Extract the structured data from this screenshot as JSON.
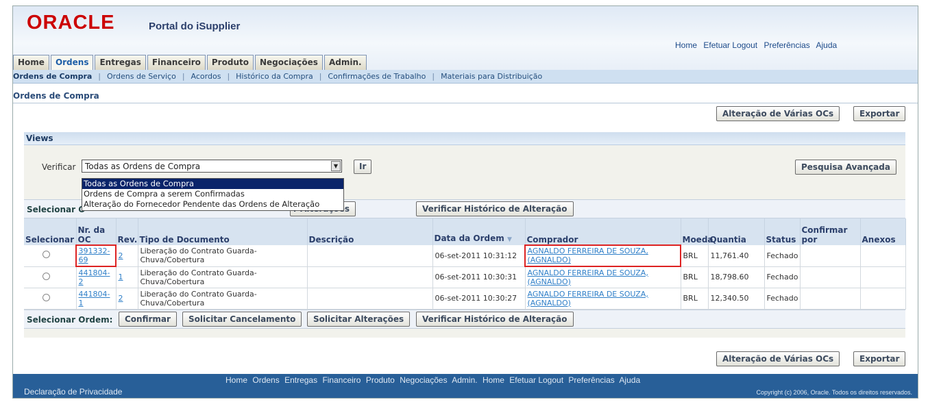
{
  "header": {
    "logo": "ORACLE",
    "portal_title": "Portal do iSupplier",
    "global_links": [
      "Home",
      "Efetuar Logout",
      "Preferências",
      "Ajuda"
    ]
  },
  "tabs": [
    "Home",
    "Ordens",
    "Entregas",
    "Financeiro",
    "Produto",
    "Negociações",
    "Admin."
  ],
  "active_tab": "Ordens",
  "subnav": [
    "Ordens de Compra",
    "Ordens de Serviço",
    "Acordos",
    "Histórico da Compra",
    "Confirmações de Trabalho",
    "Materiais para Distribuição"
  ],
  "page_title": "Ordens de Compra",
  "actions": {
    "multi_change": "Alteração de Várias OCs",
    "export": "Exportar"
  },
  "views": {
    "title": "Views",
    "verify_label": "Verificar",
    "selected": "Todas as Ordens de Compra",
    "options": [
      "Todas as Ordens de Compra",
      "Ordens de Compra a serem Confirmadas",
      "Alteração do Fornecedor Pendente das Ordens de Alteração"
    ],
    "go": "Ir",
    "advanced_search": "Pesquisa Avançada"
  },
  "select_bar": {
    "label": "Selecionar Ordem:",
    "label_partial": "Selecionar O",
    "confirm": "Confirmar",
    "cancel_request": "Solicitar Cancelamento",
    "request_changes": "Solicitar Alterações",
    "request_changes_partial": "r Alterações",
    "change_history": "Verificar Histórico de Alteração"
  },
  "columns": {
    "select": "Selecionar",
    "oc_num_1": "Nr. da",
    "oc_num_2": "OC",
    "rev": "Rev.",
    "doc_type": "Tipo de Documento",
    "description": "Descrição",
    "order_date": "Data da Ordem",
    "buyer": "Comprador",
    "currency": "Moeda",
    "amount": "Quantia",
    "status": "Status",
    "confirm_by_1": "Confirmar",
    "confirm_by_2": "por",
    "attachments": "Anexos"
  },
  "rows": [
    {
      "oc": "391332-69",
      "oc_a": "391332-",
      "oc_b": "69",
      "rev": "2",
      "doc_type": "Liberação do Contrato Guarda-Chuva/Cobertura",
      "description": "",
      "date": "06-set-2011 10:31:12",
      "buyer": "AGNALDO FERREIRA DE SOUZA, (AGNALDO)",
      "currency": "BRL",
      "amount": "11,761.40",
      "status": "Fechado"
    },
    {
      "oc": "441804-2",
      "rev": "1",
      "doc_type": "Liberação do Contrato Guarda-Chuva/Cobertura",
      "description": "",
      "date": "06-set-2011 10:30:31",
      "buyer": "AGNALDO FERREIRA DE SOUZA, (AGNALDO)",
      "currency": "BRL",
      "amount": "18,798.60",
      "status": "Fechado"
    },
    {
      "oc": "441804-1",
      "rev": "2",
      "doc_type": "Liberação do Contrato Guarda-Chuva/Cobertura",
      "description": "",
      "date": "06-set-2011 10:30:27",
      "buyer": "AGNALDO FERREIRA DE SOUZA, (AGNALDO)",
      "currency": "BRL",
      "amount": "12,340.50",
      "status": "Fechado"
    }
  ],
  "footer": {
    "links": [
      "Home",
      "Ordens",
      "Entregas",
      "Financeiro",
      "Produto",
      "Negociações",
      "Admin.",
      "Home",
      "Efetuar Logout",
      "Preferências",
      "Ajuda"
    ],
    "privacy": "Declaração de Privacidade",
    "copyright": "Copyright (c) 2006, Oracle. Todos os direitos reservados."
  }
}
